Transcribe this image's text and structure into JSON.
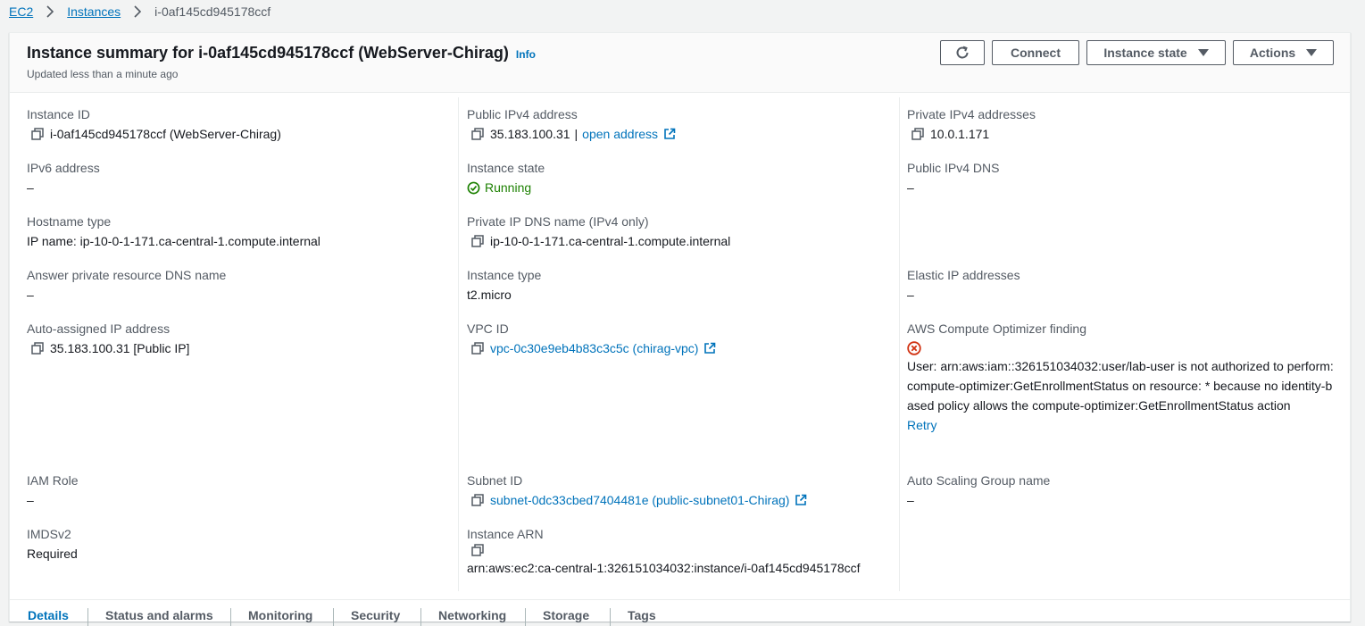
{
  "breadcrumb": {
    "ec2": "EC2",
    "instances": "Instances",
    "current": "i-0af145cd945178ccf"
  },
  "header": {
    "title": "Instance summary for i-0af145cd945178ccf (WebServer-Chirag)",
    "info": "Info",
    "subtitle": "Updated less than a minute ago",
    "connect": "Connect",
    "instance_state": "Instance state",
    "actions": "Actions"
  },
  "col1": {
    "instance_id_label": "Instance ID",
    "instance_id": "i-0af145cd945178ccf (WebServer-Chirag)",
    "ipv6_label": "IPv6 address",
    "ipv6": "–",
    "hostname_type_label": "Hostname type",
    "hostname_type": "IP name: ip-10-0-1-171.ca-central-1.compute.internal",
    "answer_dns_label": "Answer private resource DNS name",
    "answer_dns": "–",
    "auto_ip_label": "Auto-assigned IP address",
    "auto_ip": "35.183.100.31 [Public IP]",
    "iam_label": "IAM Role",
    "iam": "–",
    "imds_label": "IMDSv2",
    "imds": "Required"
  },
  "col2": {
    "public_ipv4_label": "Public IPv4 address",
    "public_ipv4": "35.183.100.31",
    "public_ipv4_sep": "|",
    "open_address": "open address",
    "state_label": "Instance state",
    "state": "Running",
    "private_dns_label": "Private IP DNS name (IPv4 only)",
    "private_dns": "ip-10-0-1-171.ca-central-1.compute.internal",
    "type_label": "Instance type",
    "type": "t2.micro",
    "vpc_label": "VPC ID",
    "vpc": "vpc-0c30e9eb4b83c3c5c (chirag-vpc)",
    "subnet_label": "Subnet ID",
    "subnet": "subnet-0dc33cbed7404481e (public-subnet01-Chirag)",
    "arn_label": "Instance ARN",
    "arn": "arn:aws:ec2:ca-central-1:326151034032:instance/i-0af145cd945178ccf"
  },
  "col3": {
    "private_ipv4_label": "Private IPv4 addresses",
    "private_ipv4": "10.0.1.171",
    "public_dns_label": "Public IPv4 DNS",
    "public_dns": "–",
    "elastic_label": "Elastic IP addresses",
    "elastic": "–",
    "optimizer_label": "AWS Compute Optimizer finding",
    "optimizer_error": "User: arn:aws:iam::326151034032:user/lab-user is not authorized to perform: compute-optimizer:GetEnrollmentStatus on resource: * because no identity-based policy allows the compute-optimizer:GetEnrollmentStatus action",
    "retry": "Retry",
    "asg_label": "Auto Scaling Group name",
    "asg": "–"
  },
  "tabs": [
    "Details",
    "Status and alarms",
    "Monitoring",
    "Security",
    "Networking",
    "Storage",
    "Tags"
  ],
  "colors": {
    "link": "#0073bb",
    "running": "#1d8102",
    "error": "#d13212",
    "text": "#16191f",
    "muted": "#545b64"
  }
}
